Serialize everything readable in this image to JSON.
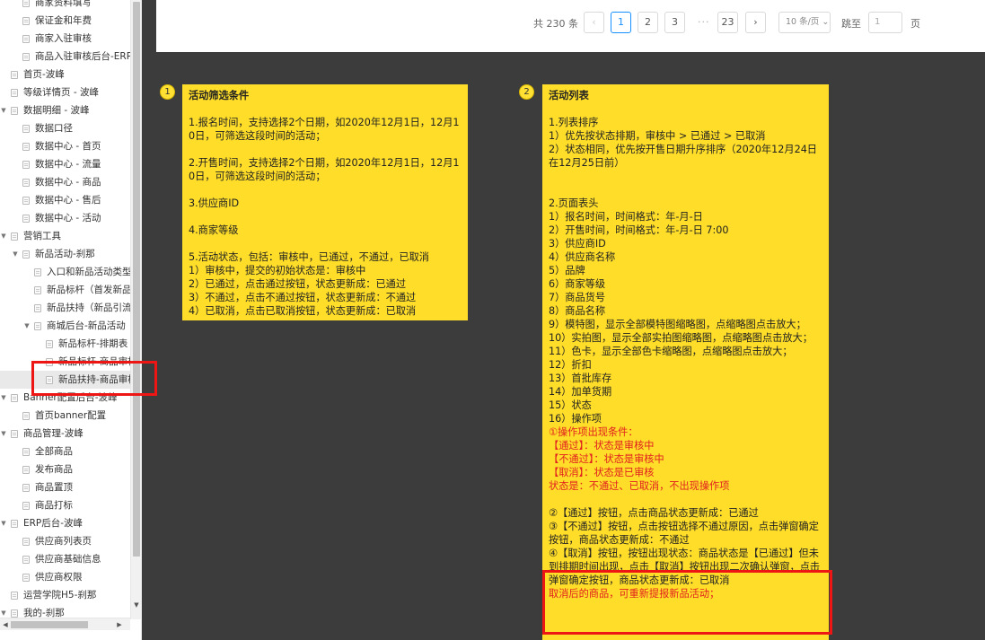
{
  "sidebar": {
    "items": [
      {
        "label": "商家资料填写",
        "depth": 2,
        "tw": ""
      },
      {
        "label": "保证金和年费",
        "depth": 2,
        "tw": ""
      },
      {
        "label": "商家入驻审核",
        "depth": 2,
        "tw": ""
      },
      {
        "label": "商品入驻审核后台-ERP",
        "depth": 2,
        "tw": ""
      },
      {
        "label": "首页-波峰",
        "depth": 1,
        "tw": ""
      },
      {
        "label": "等级详情页 - 波峰",
        "depth": 1,
        "tw": ""
      },
      {
        "label": "数据明细 - 波峰",
        "depth": 1,
        "tw": "▼"
      },
      {
        "label": "数据口径",
        "depth": 2,
        "tw": ""
      },
      {
        "label": "数据中心 - 首页",
        "depth": 2,
        "tw": ""
      },
      {
        "label": "数据中心 - 流量",
        "depth": 2,
        "tw": ""
      },
      {
        "label": "数据中心 - 商品",
        "depth": 2,
        "tw": ""
      },
      {
        "label": "数据中心 - 售后",
        "depth": 2,
        "tw": ""
      },
      {
        "label": "数据中心 - 活动",
        "depth": 2,
        "tw": ""
      },
      {
        "label": "营销工具",
        "depth": 1,
        "tw": "▼"
      },
      {
        "label": "新品活动-刹那",
        "depth": 2,
        "tw": "▼"
      },
      {
        "label": "入口和新品活动类型",
        "depth": 3,
        "tw": ""
      },
      {
        "label": "新品标杆（首发新品",
        "depth": 3,
        "tw": ""
      },
      {
        "label": "新品扶持（新品引流",
        "depth": 3,
        "tw": ""
      },
      {
        "label": "商城后台-新品活动",
        "depth": 3,
        "tw": "▼"
      },
      {
        "label": "新品标杆-排期表",
        "depth": 4,
        "tw": ""
      },
      {
        "label": "新品标杆-商品审核",
        "depth": 4,
        "tw": ""
      },
      {
        "label": "新品扶持-商品审核",
        "depth": 4,
        "tw": "",
        "selected": true
      },
      {
        "label": "Banner配置后台-波峰",
        "depth": 1,
        "tw": "▼"
      },
      {
        "label": "首页banner配置",
        "depth": 2,
        "tw": ""
      },
      {
        "label": "商品管理-波峰",
        "depth": 1,
        "tw": "▼"
      },
      {
        "label": "全部商品",
        "depth": 2,
        "tw": ""
      },
      {
        "label": "发布商品",
        "depth": 2,
        "tw": ""
      },
      {
        "label": "商品置顶",
        "depth": 2,
        "tw": ""
      },
      {
        "label": "商品打标",
        "depth": 2,
        "tw": ""
      },
      {
        "label": "ERP后台-波峰",
        "depth": 1,
        "tw": "▼"
      },
      {
        "label": "供应商列表页",
        "depth": 2,
        "tw": ""
      },
      {
        "label": "供应商基础信息",
        "depth": 2,
        "tw": ""
      },
      {
        "label": "供应商权限",
        "depth": 2,
        "tw": ""
      },
      {
        "label": "运营学院H5-刹那",
        "depth": 1,
        "tw": ""
      },
      {
        "label": "我的-刹那",
        "depth": 1,
        "tw": "▼"
      }
    ]
  },
  "pagination": {
    "total_text": "共 230 条",
    "prev": "‹",
    "pages": [
      "1",
      "2",
      "3"
    ],
    "dots": "···",
    "last_page": "23",
    "next": "›",
    "page_size": "10 条/页 ⌄",
    "jump_label": "跳至",
    "jump_value": "1",
    "page_suffix": "页"
  },
  "notes": [
    {
      "badge": "1",
      "lines": [
        {
          "text": "活动筛选条件",
          "style": "title"
        },
        {
          "text": ""
        },
        {
          "text": "1.报名时间，支持选择2个日期，如2020年12月1日，12月10日，可筛选这段时间的活动；"
        },
        {
          "text": ""
        },
        {
          "text": "2.开售时间，支持选择2个日期，如2020年12月1日，12月10日，可筛选这段时间的活动；"
        },
        {
          "text": ""
        },
        {
          "text": "3.供应商ID"
        },
        {
          "text": ""
        },
        {
          "text": "4.商家等级"
        },
        {
          "text": ""
        },
        {
          "text": "5.活动状态，包括：审核中，已通过，不通过，已取消"
        },
        {
          "text": "1）审核中，提交的初始状态是：审核中"
        },
        {
          "text": "2）已通过，点击通过按钮，状态更新成：已通过"
        },
        {
          "text": "3）不通过，点击不通过按钮，状态更新成：不通过"
        },
        {
          "text": "4）已取消，点击已取消按钮，状态更新成：已取消"
        }
      ]
    },
    {
      "badge": "2",
      "lines": [
        {
          "text": "活动列表",
          "style": "title"
        },
        {
          "text": ""
        },
        {
          "text": "1.列表排序"
        },
        {
          "text": "1）优先按状态排期，审核中 > 已通过 > 已取消"
        },
        {
          "text": "2）状态相同，优先按开售日期升序排序（2020年12月24日在12月25日前）"
        },
        {
          "text": ""
        },
        {
          "text": ""
        },
        {
          "text": "2.页面表头"
        },
        {
          "text": "1）报名时间，时间格式：年-月-日"
        },
        {
          "text": "2）开售时间，时间格式：年-月-日 7:00"
        },
        {
          "text": "3）供应商ID"
        },
        {
          "text": "4）供应商名称"
        },
        {
          "text": "5）品牌"
        },
        {
          "text": "6）商家等级"
        },
        {
          "text": "7）商品货号"
        },
        {
          "text": "8）商品名称"
        },
        {
          "text": "9）模特图，显示全部模特图缩略图，点缩略图点击放大；"
        },
        {
          "text": "10）实拍图，显示全部实拍图缩略图，点缩略图点击放大；"
        },
        {
          "text": "11）色卡，显示全部色卡缩略图，点缩略图点击放大；"
        },
        {
          "text": "12）折扣"
        },
        {
          "text": "13）首批库存"
        },
        {
          "text": "14）加单货期"
        },
        {
          "text": "15）状态"
        },
        {
          "text": "16）操作项"
        },
        {
          "text": "①操作项出现条件：",
          "style": "red"
        },
        {
          "text": "【通过】：状态是审核中",
          "style": "red"
        },
        {
          "text": "【不通过】：状态是审核中",
          "style": "red"
        },
        {
          "text": "【取消】：状态是已审核",
          "style": "red"
        },
        {
          "text": "状态是：不通过、已取消，不出现操作项",
          "style": "red"
        },
        {
          "text": ""
        },
        {
          "text": "②【通过】按钮，点击商品状态更新成：已通过"
        },
        {
          "text": "③【不通过】按钮，点击按钮选择不通过原因，点击弹窗确定按钮，商品状态更新成：不通过"
        },
        {
          "text": "④【取消】按钮，按钮出现状态：商品状态是【已通过】但未到排期时间出现，点击【取消】按钮出现二次确认弹窗，点击弹窗确定按钮，商品状态更新成：已取消"
        },
        {
          "text": "取消后的商品，可重新提报新品活动；",
          "style": "red"
        }
      ]
    }
  ],
  "colors": {
    "note_bg": "#ffdd28",
    "canvas_bg": "#3c3c3c",
    "highlight": "#ee1515",
    "accent": "#1890ff"
  }
}
